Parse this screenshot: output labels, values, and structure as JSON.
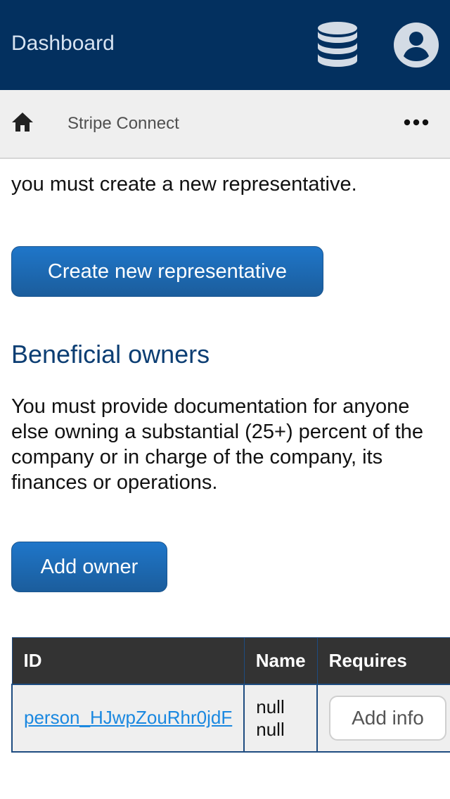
{
  "header": {
    "title": "Dashboard",
    "icons": [
      "database-icon",
      "user-account-icon"
    ],
    "background": "#03305f"
  },
  "breadcrumb": {
    "home_icon": "home-icon",
    "label": "Stripe Connect",
    "more_icon": "more-horizontal-icon"
  },
  "representatives": {
    "text_tail": "you must create a new representative.",
    "create_button": "Create new representative"
  },
  "owners": {
    "heading": "Beneficial owners",
    "description": "You must provide documentation for anyone else owning a substantial (25+) percent of the company or in charge of the company, its finances or operations.",
    "add_button": "Add owner",
    "table": {
      "columns": [
        "ID",
        "Name",
        "Requires"
      ],
      "rows": [
        {
          "id": "person_HJwpZouRhr0jdF",
          "name": "null null",
          "action": "Add info"
        }
      ]
    }
  },
  "colors": {
    "accent": "#1f76c9",
    "heading": "#0c3e73",
    "table_header": "#333333",
    "link": "#1a88e0"
  }
}
